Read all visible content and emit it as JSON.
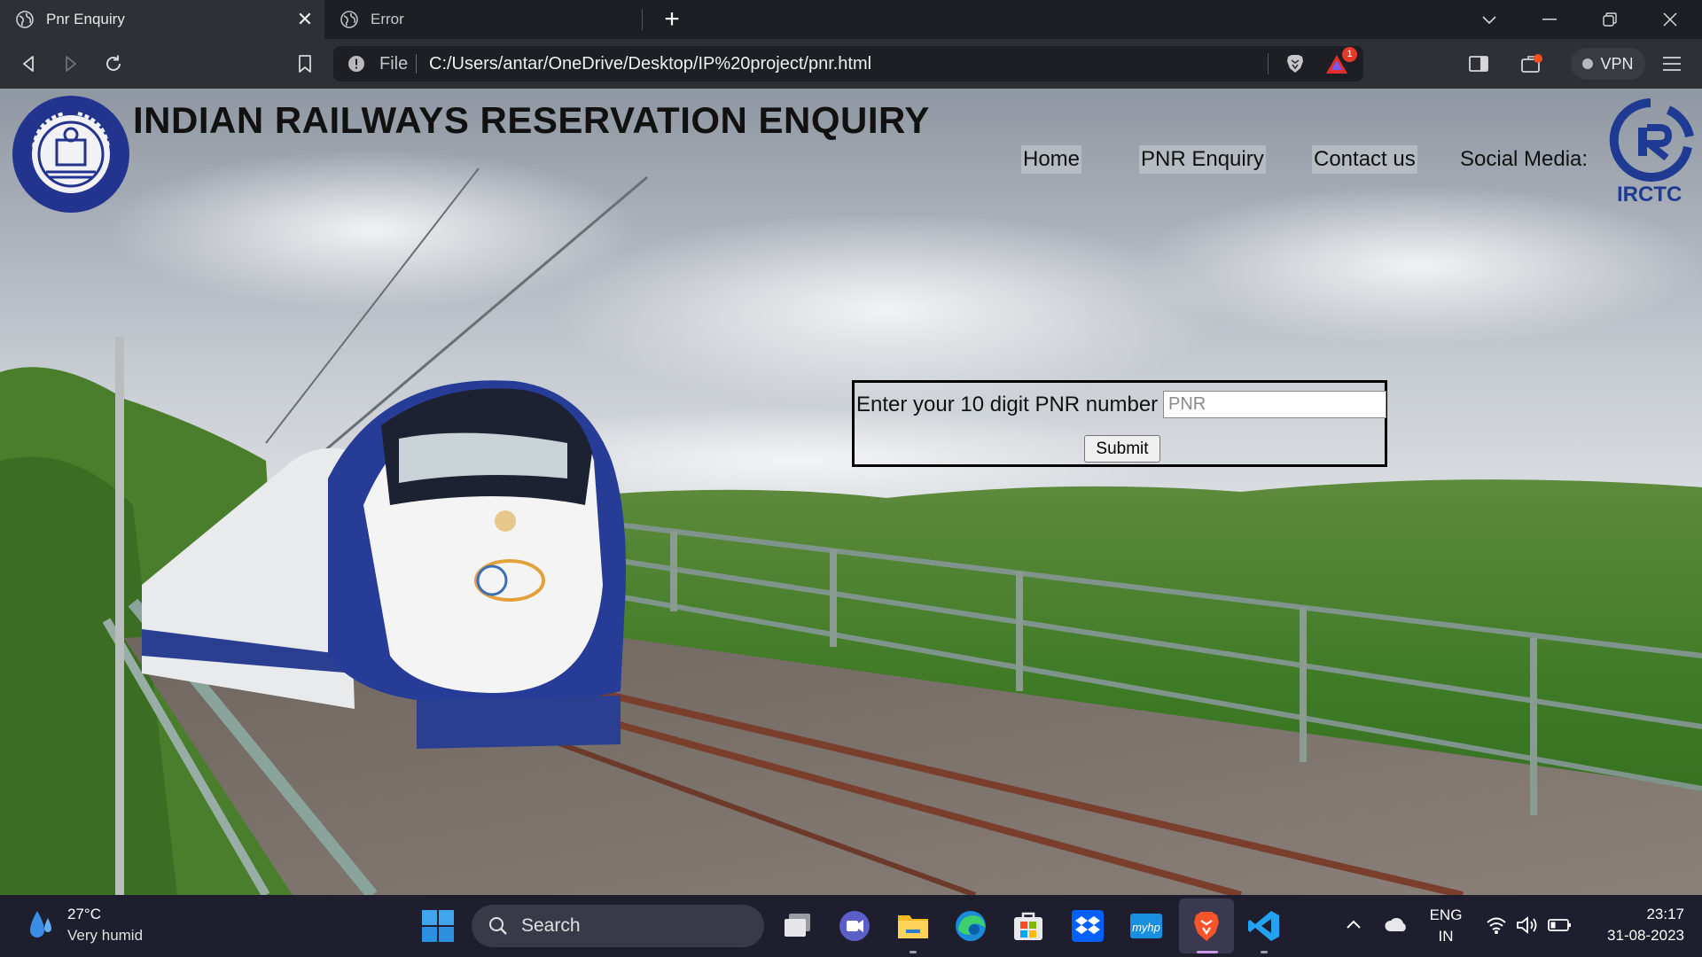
{
  "browser": {
    "tabs": [
      {
        "label": "Pnr Enquiry",
        "active": true
      },
      {
        "label": "Error",
        "active": false
      }
    ],
    "address": {
      "scheme_label": "File",
      "url": "C:/Users/antar/OneDrive/Desktop/IP%20project/pnr.html"
    },
    "shield_alert_count": "1",
    "vpn_label": "VPN"
  },
  "page": {
    "title": "INDIAN RAILWAYS RESERVATION ENQUIRY",
    "nav": [
      "Home",
      "PNR Enquiry",
      "Contact us",
      "Social Media:"
    ],
    "logo_left": "Indian Railways emblem",
    "logo_right_text": "IRCTC",
    "form": {
      "label": "Enter your 10 digit PNR number",
      "input_value": "",
      "input_placeholder": "PNR",
      "submit_label": "Submit"
    }
  },
  "taskbar": {
    "weather": {
      "temp": "27°C",
      "condition": "Very humid"
    },
    "search_placeholder": "Search",
    "language": {
      "line1": "ENG",
      "line2": "IN"
    },
    "clock": {
      "time": "23:17",
      "date": "31-08-2023"
    }
  },
  "colors": {
    "irctc_blue": "#1f3a93",
    "ir_emblem_blue": "#23348f",
    "taskbar": "#1f1e2e",
    "brave_orange": "#fb542b"
  }
}
